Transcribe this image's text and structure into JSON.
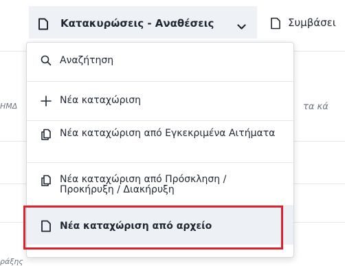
{
  "menubar": {
    "active_tab": {
      "label": "Κατακυρώσεις - Αναθέσεις",
      "icon": "document-icon",
      "chevron": "chevron-down-icon"
    },
    "next_tab": {
      "label": "Συμβάσει",
      "icon": "document-icon"
    }
  },
  "background": {
    "left_fragment": "ΗΜΔ",
    "right_fragment": "τα κά",
    "bottom_fragment": "ράξης"
  },
  "dropdown": {
    "items": [
      {
        "label": "Αναζήτηση",
        "icon": "search-icon"
      },
      {
        "label": "Νέα καταχώριση",
        "icon": "plus-icon"
      },
      {
        "label": "Νέα καταχώριση από Εγκεκριμένα Αιτήματα",
        "icon": "copy-document-icon"
      },
      {
        "label": "Νέα καταχώριση από Πρόσκληση / Προκήρυξη / Διακήρυξη",
        "icon": "copy-document-icon"
      },
      {
        "label": "Νέα καταχώριση από αρχείο",
        "icon": "document-icon"
      }
    ]
  },
  "colors": {
    "highlight_border": "#e0202a",
    "active_tab_bg": "#eef1f5"
  }
}
